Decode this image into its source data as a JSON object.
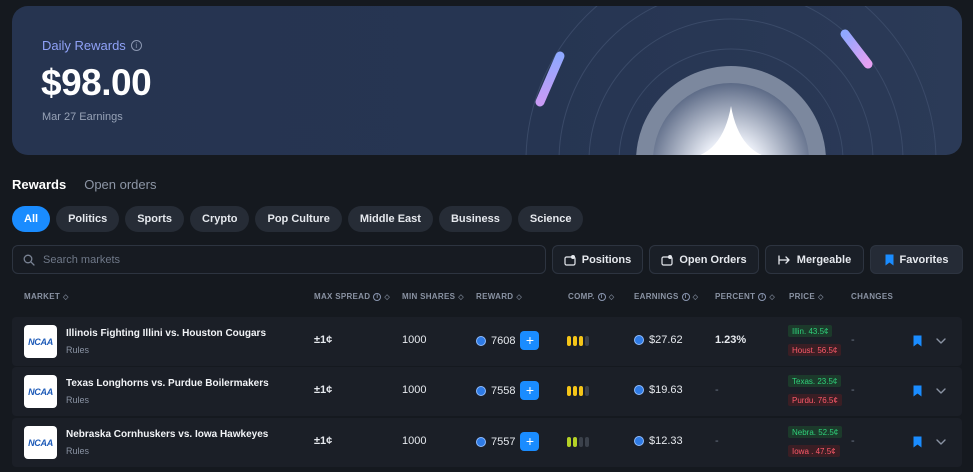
{
  "banner": {
    "title": "Daily Rewards",
    "amount": "$98.00",
    "subtitle": "Mar 27 Earnings"
  },
  "tabs": [
    {
      "label": "Rewards",
      "active": true
    },
    {
      "label": "Open orders",
      "active": false
    }
  ],
  "filters": [
    {
      "label": "All",
      "active": true
    },
    {
      "label": "Politics"
    },
    {
      "label": "Sports"
    },
    {
      "label": "Crypto"
    },
    {
      "label": "Pop Culture"
    },
    {
      "label": "Middle East"
    },
    {
      "label": "Business"
    },
    {
      "label": "Science"
    }
  ],
  "search": {
    "placeholder": "Search markets"
  },
  "actions": {
    "positions": "Positions",
    "open_orders": "Open Orders",
    "mergeable": "Mergeable",
    "favorites": "Favorites"
  },
  "columns": {
    "market": "MARKET",
    "max_spread": "MAX SPREAD",
    "min_shares": "MIN SHARES",
    "reward": "REWARD",
    "comp": "COMP.",
    "earnings": "EARNINGS",
    "percent": "PERCENT",
    "price": "PRICE",
    "changes": "CHANGES"
  },
  "rows": [
    {
      "logo": "NCAA",
      "name": "Illinois Fighting Illini vs. Houston Cougars",
      "rules": "Rules",
      "max_spread": "±1¢",
      "min_shares": "1000",
      "reward": "7608",
      "comp_level": 3,
      "comp_color": "#f5c518",
      "earnings": "$27.62",
      "percent": "1.23%",
      "price_up": "Illin. 43.5¢",
      "price_down": "Houst. 56.5¢",
      "changes": "-"
    },
    {
      "logo": "NCAA",
      "name": "Texas Longhorns vs. Purdue Boilermakers",
      "rules": "Rules",
      "max_spread": "±1¢",
      "min_shares": "1000",
      "reward": "7558",
      "comp_level": 3,
      "comp_color": "#f5c518",
      "earnings": "$19.63",
      "percent": "-",
      "price_up": "Texas. 23.5¢",
      "price_down": "Purdu. 76.5¢",
      "changes": "-"
    },
    {
      "logo": "NCAA",
      "name": "Nebraska Cornhuskers vs. Iowa Hawkeyes",
      "rules": "Rules",
      "max_spread": "±1¢",
      "min_shares": "1000",
      "reward": "7557",
      "comp_level": 2,
      "comp_color": "#b5d126",
      "earnings": "$12.33",
      "percent": "-",
      "price_up": "Nebra. 52.5¢",
      "price_down": "Iowa . 47.5¢",
      "changes": "-"
    }
  ]
}
